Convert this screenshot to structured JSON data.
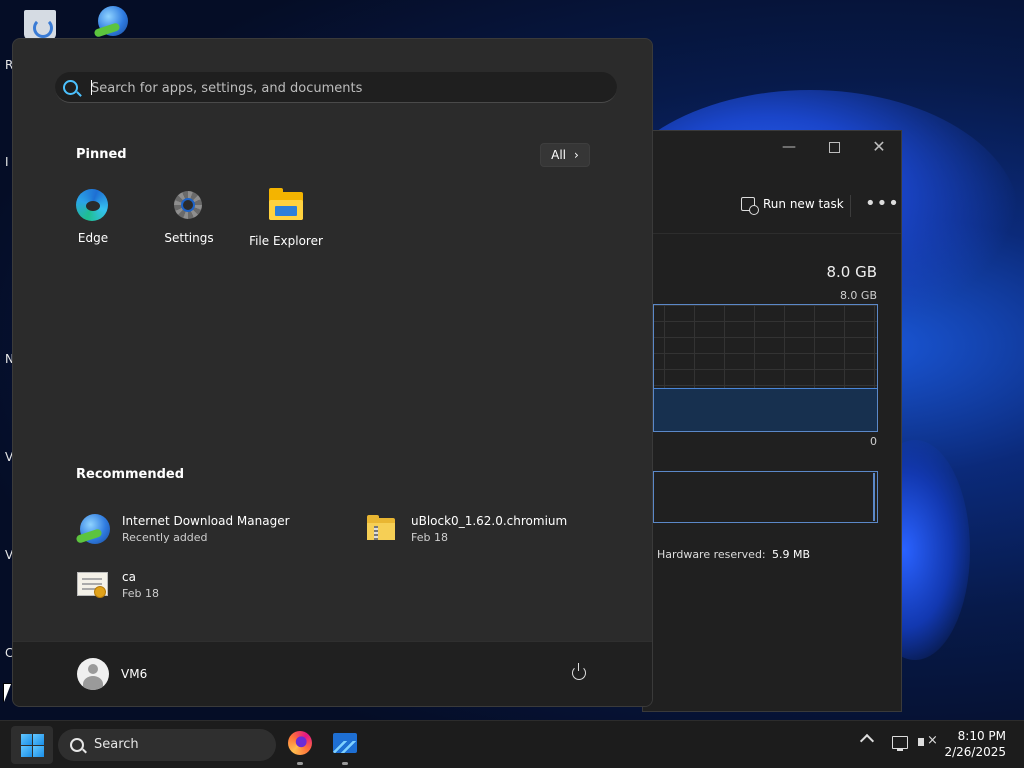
{
  "desktop": {
    "edge_letters": [
      "R",
      "I",
      "N",
      "V",
      "V",
      "C"
    ]
  },
  "task_manager": {
    "run_new_task": "Run new task",
    "more": "•••",
    "memory_total": "8.0 GB",
    "graph_max": "8.0 GB",
    "graph_min": "0",
    "hardware_reserved_label": "Hardware reserved:",
    "hardware_reserved_value": "5.9 MB",
    "memory_fill_fraction": 0.33
  },
  "start_menu": {
    "search_placeholder": "Search for apps, settings, and documents",
    "pinned_title": "Pinned",
    "all_label": "All",
    "pinned": [
      {
        "label": "Edge",
        "icon": "edge-icon"
      },
      {
        "label": "Settings",
        "icon": "gear-icon"
      },
      {
        "label": "File Explorer",
        "icon": "folder-icon"
      }
    ],
    "recommended_title": "Recommended",
    "recommended": [
      {
        "name": "Internet Download Manager",
        "sub": "Recently added",
        "icon": "idm-icon"
      },
      {
        "name": "uBlock0_1.62.0.chromium",
        "sub": "Feb 18",
        "icon": "zip-folder-icon"
      },
      {
        "name": "ca",
        "sub": "Feb 18",
        "icon": "certificate-icon"
      }
    ],
    "user_name": "VM6"
  },
  "taskbar": {
    "search_label": "Search",
    "time": "8:10 PM",
    "date": "2/26/2025"
  },
  "colors": {
    "accent": "#4cc2ff",
    "start_bg": "#2b2b2b",
    "taskbar_bg": "#1c1c1c"
  }
}
